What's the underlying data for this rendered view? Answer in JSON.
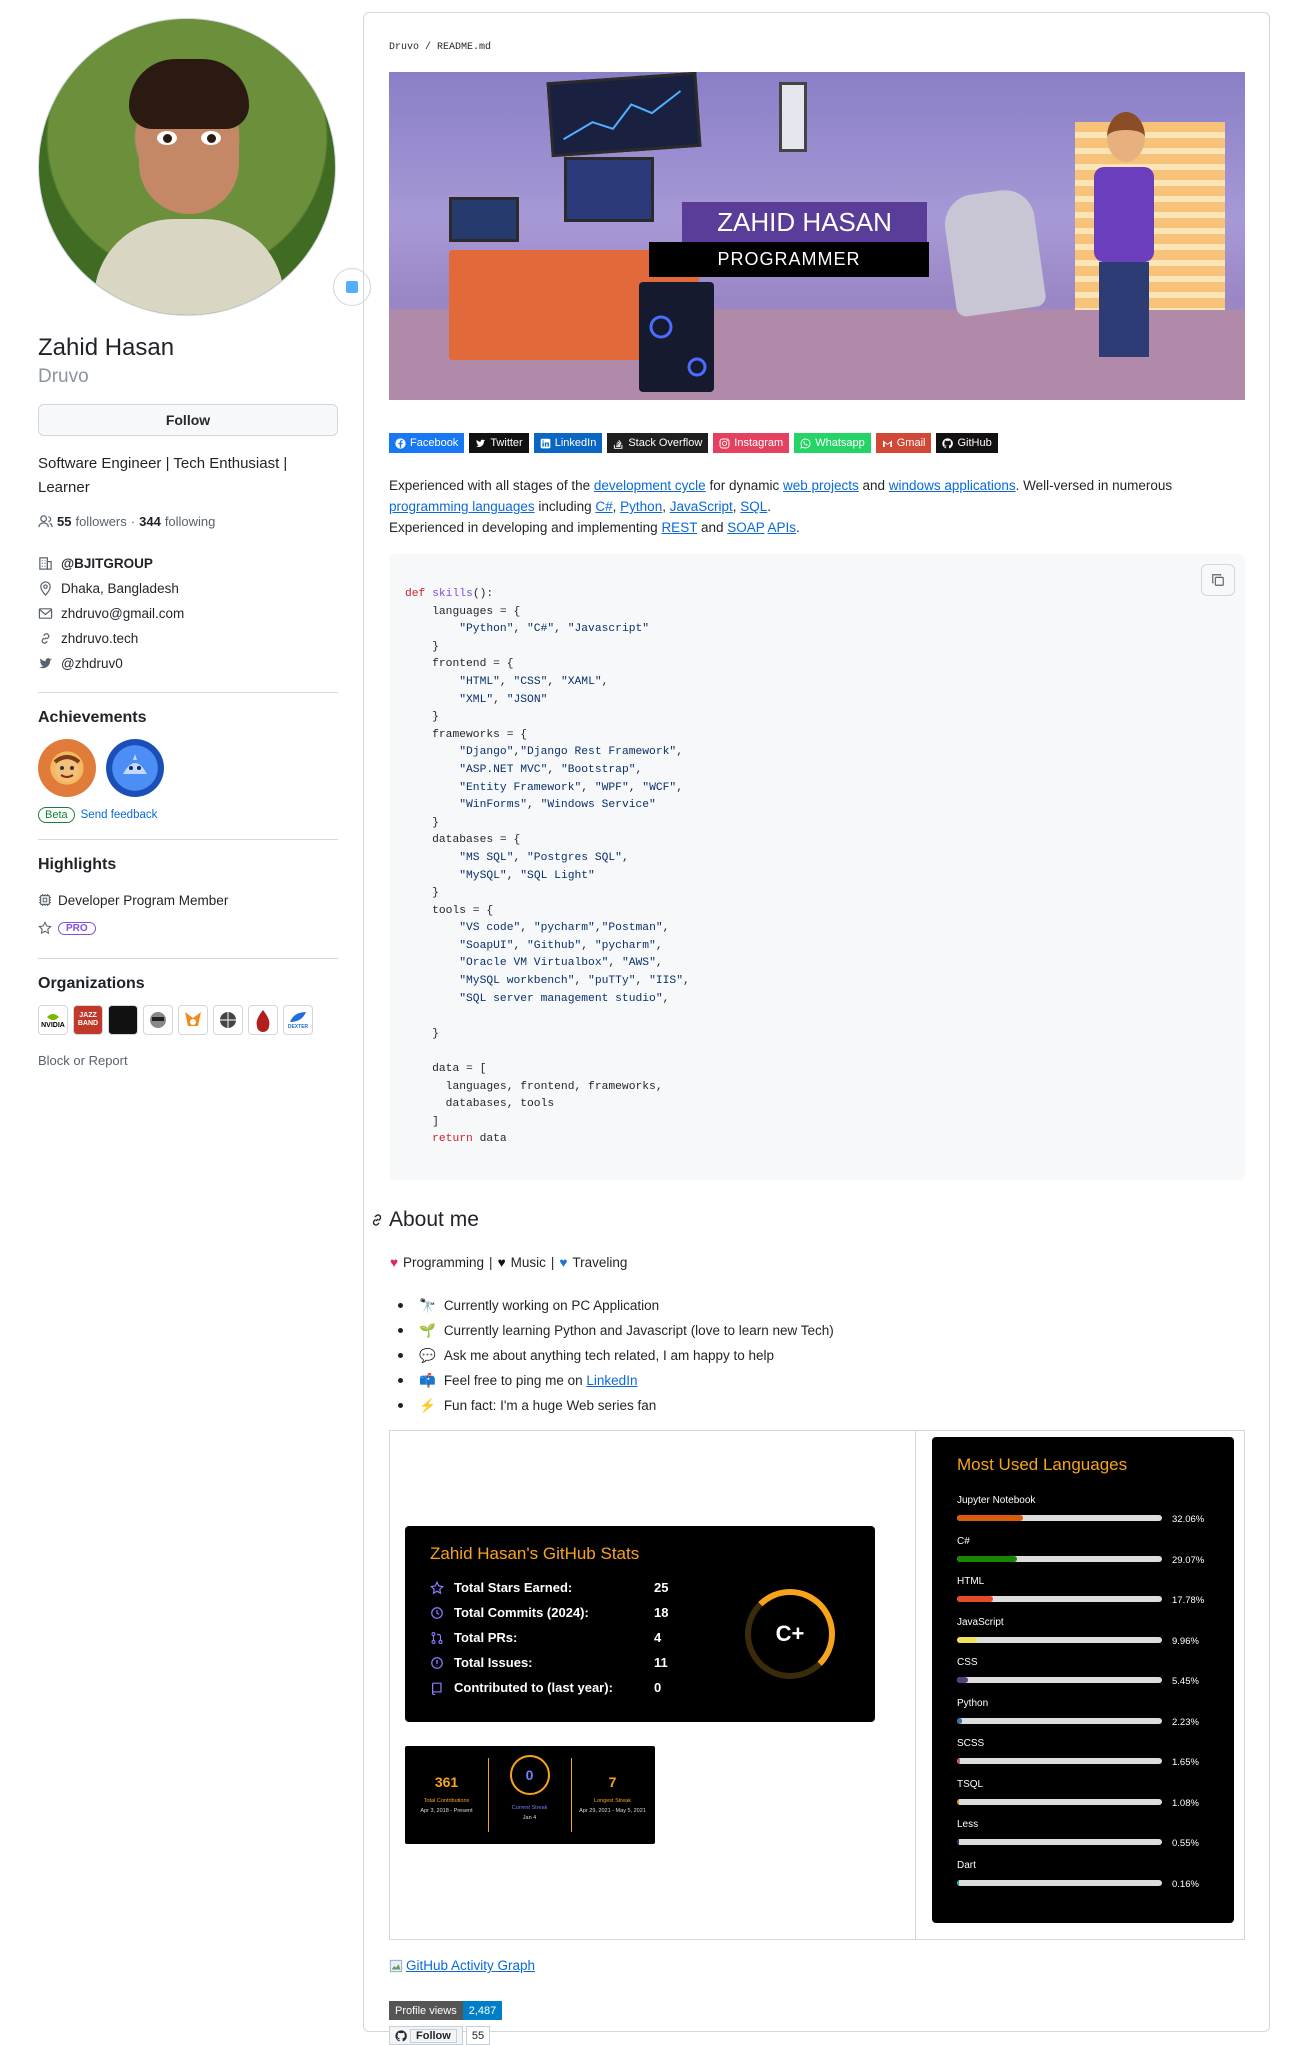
{
  "profile": {
    "name": "Zahid Hasan",
    "login": "Druvo",
    "follow_label": "Follow",
    "bio": "Software Engineer | Tech Enthusiast | Learner",
    "followers_count": "55",
    "followers_label": "followers",
    "following_count": "344",
    "following_label": "following",
    "company": "@BJITGROUP",
    "location": "Dhaka, Bangladesh",
    "email": "zhdruvo@gmail.com",
    "website": "zhdruvo.tech",
    "twitter": "@zhdruv0"
  },
  "achievements": {
    "heading": "Achievements",
    "beta": "Beta",
    "feedback": "Send feedback"
  },
  "highlights": {
    "heading": "Highlights",
    "item1": "Developer Program Member",
    "pro": "PRO"
  },
  "organizations": {
    "heading": "Organizations",
    "items": [
      "NVIDIA",
      "JAZZ BAND",
      "",
      "",
      "",
      "",
      "",
      "DEXTER"
    ],
    "block": "Block or Report"
  },
  "readme": {
    "crumb": "Druvo / README.md",
    "banner_title": "ZAHID HASAN",
    "banner_subtitle": "PROGRAMMER",
    "socials": [
      {
        "label": "Facebook",
        "color": "#1877f2"
      },
      {
        "label": "Twitter",
        "color": "#000000"
      },
      {
        "label": "LinkedIn",
        "color": "#0a66c2"
      },
      {
        "label": "Stack Overflow",
        "color": "#1f1f1f"
      },
      {
        "label": "Instagram",
        "color": "#e4405f"
      },
      {
        "label": "Whatsapp",
        "color": "#25d366"
      },
      {
        "label": "Gmail",
        "color": "#d14836"
      },
      {
        "label": "GitHub",
        "color": "#121011"
      }
    ],
    "para": {
      "p1": "Experienced with all stages of the ",
      "l1": "development cycle",
      "p2": " for dynamic ",
      "l2": "web projects",
      "p3": " and ",
      "l3": "windows applications",
      "p4": ". Well-versed in numerous ",
      "l4": "programming languages",
      "p5": " including ",
      "l5": "C#",
      "p6": ", ",
      "l6": "Python",
      "p7": ", ",
      "l7": "JavaScript",
      "p8": ", ",
      "l8": "SQL",
      "p9": ".",
      "p10": "Experienced in developing and implementing ",
      "l10": "REST",
      "p11": " and ",
      "l11": "SOAP",
      "p12": " ",
      "l12": "APIs",
      "p13": "."
    },
    "about_heading": "About me",
    "likes": [
      "Programming",
      "Music",
      "Traveling"
    ],
    "bullets": [
      {
        "icon": "🔭",
        "text": "Currently working on PC Application"
      },
      {
        "icon": "🌱",
        "text": "Currently learning Python and Javascript (love to learn new Tech)"
      },
      {
        "icon": "💬",
        "text": "Ask me about anything tech related, I am happy to help"
      },
      {
        "icon": "📫",
        "text": "Feel free to ping me on ",
        "link": "LinkedIn"
      },
      {
        "icon": "⚡",
        "text": "Fun fact: I'm a huge Web series fan"
      }
    ]
  },
  "github_stats": {
    "title": "Zahid Hasan's GitHub Stats",
    "rows": [
      {
        "label": "Total Stars Earned:",
        "value": "25"
      },
      {
        "label": "Total Commits (2024):",
        "value": "18"
      },
      {
        "label": "Total PRs:",
        "value": "4"
      },
      {
        "label": "Total Issues:",
        "value": "11"
      },
      {
        "label": "Contributed to (last year):",
        "value": "0"
      }
    ],
    "grade": "C+"
  },
  "streak": {
    "total": "361",
    "total_label": "Total Contributions",
    "total_range": "Apr 3, 2018 - Present",
    "current": "0",
    "current_label": "Current Streak",
    "current_date": "Jan 4",
    "longest": "7",
    "longest_label": "Longest Streak",
    "longest_range": "Apr 29, 2021 - May 5, 2021"
  },
  "languages": {
    "title": "Most Used Languages",
    "items": [
      {
        "name": "Jupyter Notebook",
        "percent": "32.06%",
        "value": 32.06,
        "color": "#DA5B0B"
      },
      {
        "name": "C#",
        "percent": "29.07%",
        "value": 29.07,
        "color": "#178600"
      },
      {
        "name": "HTML",
        "percent": "17.78%",
        "value": 17.78,
        "color": "#e34c26"
      },
      {
        "name": "JavaScript",
        "percent": "9.96%",
        "value": 9.96,
        "color": "#f1e05a"
      },
      {
        "name": "CSS",
        "percent": "5.45%",
        "value": 5.45,
        "color": "#563d7c"
      },
      {
        "name": "Python",
        "percent": "2.23%",
        "value": 2.23,
        "color": "#3572A5"
      },
      {
        "name": "SCSS",
        "percent": "1.65%",
        "value": 1.65,
        "color": "#c6538c"
      },
      {
        "name": "TSQL",
        "percent": "1.08%",
        "value": 1.08,
        "color": "#e38c00"
      },
      {
        "name": "Less",
        "percent": "0.55%",
        "value": 0.55,
        "color": "#1d365d"
      },
      {
        "name": "Dart",
        "percent": "0.16%",
        "value": 0.16,
        "color": "#00B4AB"
      }
    ]
  },
  "footer": {
    "activity_graph": "GitHub Activity Graph",
    "views_label": "Profile views",
    "views_count": "2,487",
    "follow_label": "Follow",
    "follow_count": "55"
  }
}
